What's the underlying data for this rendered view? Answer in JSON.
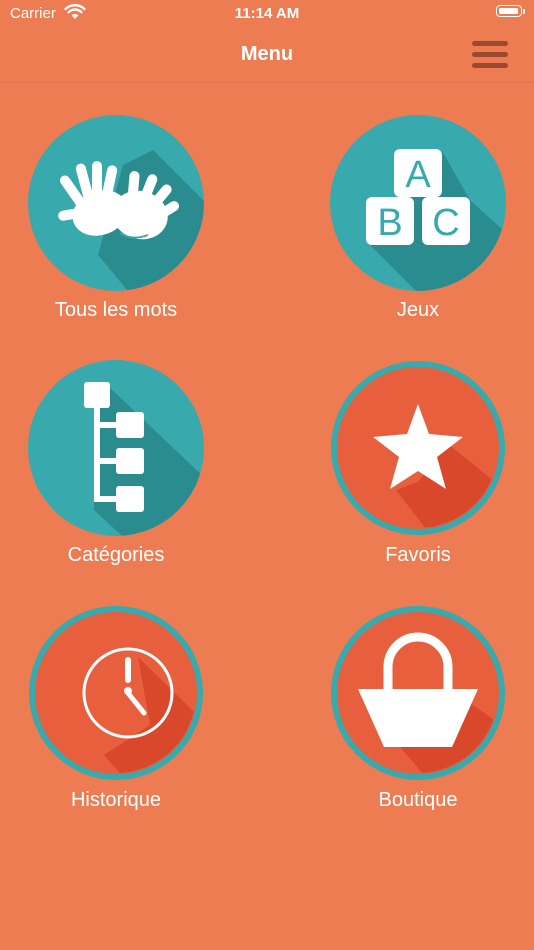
{
  "status_bar": {
    "carrier": "Carrier",
    "time": "11:14 AM",
    "battery_level": 0.95
  },
  "nav": {
    "title": "Menu",
    "menu_icon": "hamburger-menu-icon"
  },
  "colors": {
    "background": "#EE7C53",
    "teal": "#38A9AC",
    "teal_shadow": "#2A8C8F",
    "coral_inner": "#E85F3E",
    "coral_shadow": "#D9482A",
    "text": "#FFFFFF"
  },
  "tiles": [
    {
      "label": "Tous les mots",
      "icon": "signing-hands-icon"
    },
    {
      "label": "Jeux",
      "icon": "abc-blocks-icon",
      "block_letters": [
        "A",
        "B",
        "C"
      ]
    },
    {
      "label": "Catégories",
      "icon": "category-tree-icon"
    },
    {
      "label": "Favoris",
      "icon": "star-icon"
    },
    {
      "label": "Historique",
      "icon": "clock-icon"
    },
    {
      "label": "Boutique",
      "icon": "shopping-basket-icon"
    }
  ]
}
